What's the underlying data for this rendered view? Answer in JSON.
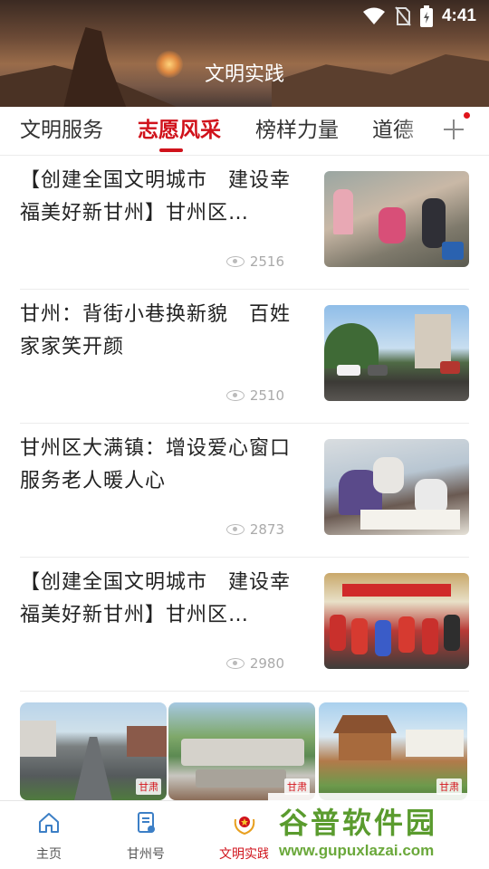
{
  "status_bar": {
    "time": "4:41"
  },
  "header": {
    "title": "文明实践"
  },
  "tabs": [
    {
      "label": "文明服务",
      "active": false
    },
    {
      "label": "志愿风采",
      "active": true
    },
    {
      "label": "榜样力量",
      "active": false
    },
    {
      "label": "道德",
      "active": false
    }
  ],
  "news": [
    {
      "title": "【创建全国文明城市　建设幸福美好新甘州】甘州区…",
      "views": "2516"
    },
    {
      "title": "甘州：背街小巷换新貌　百姓家家笑开颜",
      "views": "2510"
    },
    {
      "title": "甘州区大满镇：增设爱心窗口　　服务老人暖人心",
      "views": "2873"
    },
    {
      "title": "【创建全国文明城市　建设幸福美好新甘州】甘州区…",
      "views": "2980"
    }
  ],
  "gallery": {
    "tag": "甘肃"
  },
  "bottom_nav": [
    {
      "label": "主页",
      "icon": "home-icon",
      "active": false
    },
    {
      "label": "甘州号",
      "icon": "document-icon",
      "active": false
    },
    {
      "label": "文明实践",
      "icon": "emblem-icon",
      "active": true
    }
  ],
  "watermark": {
    "title": "谷普软件园",
    "url": "www.gupuxlazai.com"
  },
  "colors": {
    "accent": "#d0121b",
    "watermark": "#5a9b2e"
  }
}
